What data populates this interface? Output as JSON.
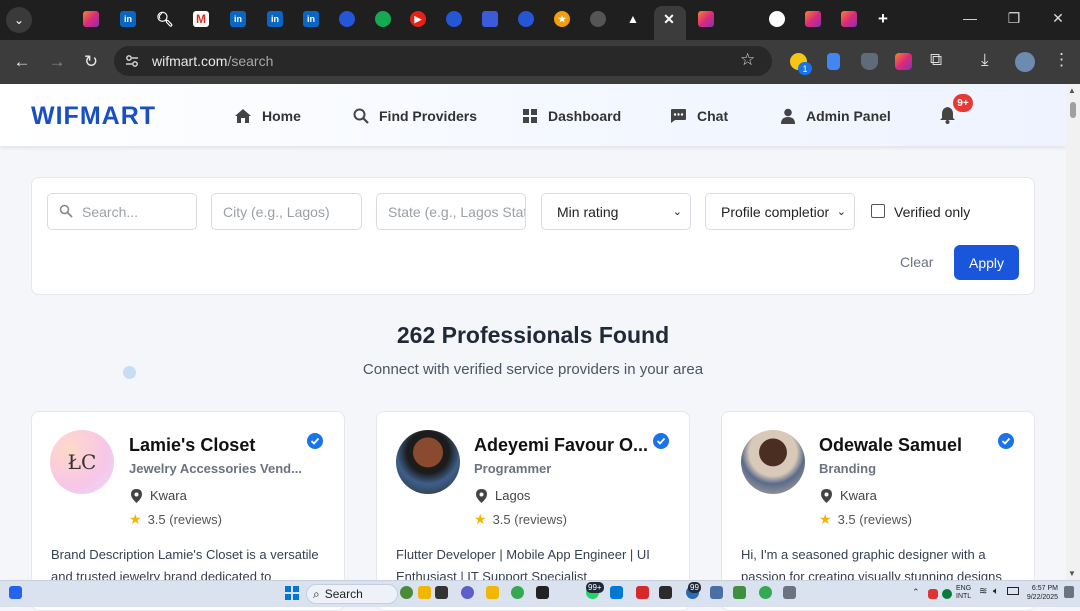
{
  "browser": {
    "url_host": "wifmart.com",
    "url_path": "/search",
    "ext_badge": "1"
  },
  "header": {
    "logo": "WIFMART",
    "nav": [
      "Home",
      "Find Providers",
      "Dashboard",
      "Chat",
      "Admin Panel"
    ],
    "notif_badge": "9+"
  },
  "filters": {
    "search_placeholder": "Search...",
    "city_placeholder": "City (e.g., Lagos)",
    "state_placeholder": "State (e.g., Lagos Stat",
    "min_rating": "Min rating",
    "profile_completion": "Profile completior",
    "verified_only": "Verified only",
    "clear": "Clear",
    "apply": "Apply"
  },
  "results": {
    "title": "262 Professionals Found",
    "subtitle": "Connect with verified service providers in your area"
  },
  "providers": [
    {
      "name": "Lamie's Closet",
      "category": "Jewelry Accessories Vend...",
      "location": "Kwara",
      "rating": "3.5",
      "reviews": "(reviews)",
      "desc1": "Brand Description Lamie's Closet is a versatile",
      "desc2": "and trusted jewelry brand dedicated to",
      "avatar_text": "ŁC"
    },
    {
      "name": "Adeyemi Favour O...",
      "category": "Programmer",
      "location": "Lagos",
      "rating": "3.5",
      "reviews": "(reviews)",
      "desc1": "Flutter Developer | Mobile App Engineer | UI",
      "desc2": "Enthusiast | IT Support Specialist"
    },
    {
      "name": "Odewale Samuel",
      "category": "Branding",
      "location": "Kwara",
      "rating": "3.5",
      "reviews": "(reviews)",
      "desc1": "Hi, I'm a seasoned graphic designer with a",
      "desc2": "passion for creating visually stunning designs"
    }
  ],
  "taskbar": {
    "search": "Search",
    "badge1": "99+",
    "badge2": "99",
    "lang1": "ENG",
    "lang2": "INTL",
    "time": "6:57 PM",
    "date": "9/22/2025"
  }
}
